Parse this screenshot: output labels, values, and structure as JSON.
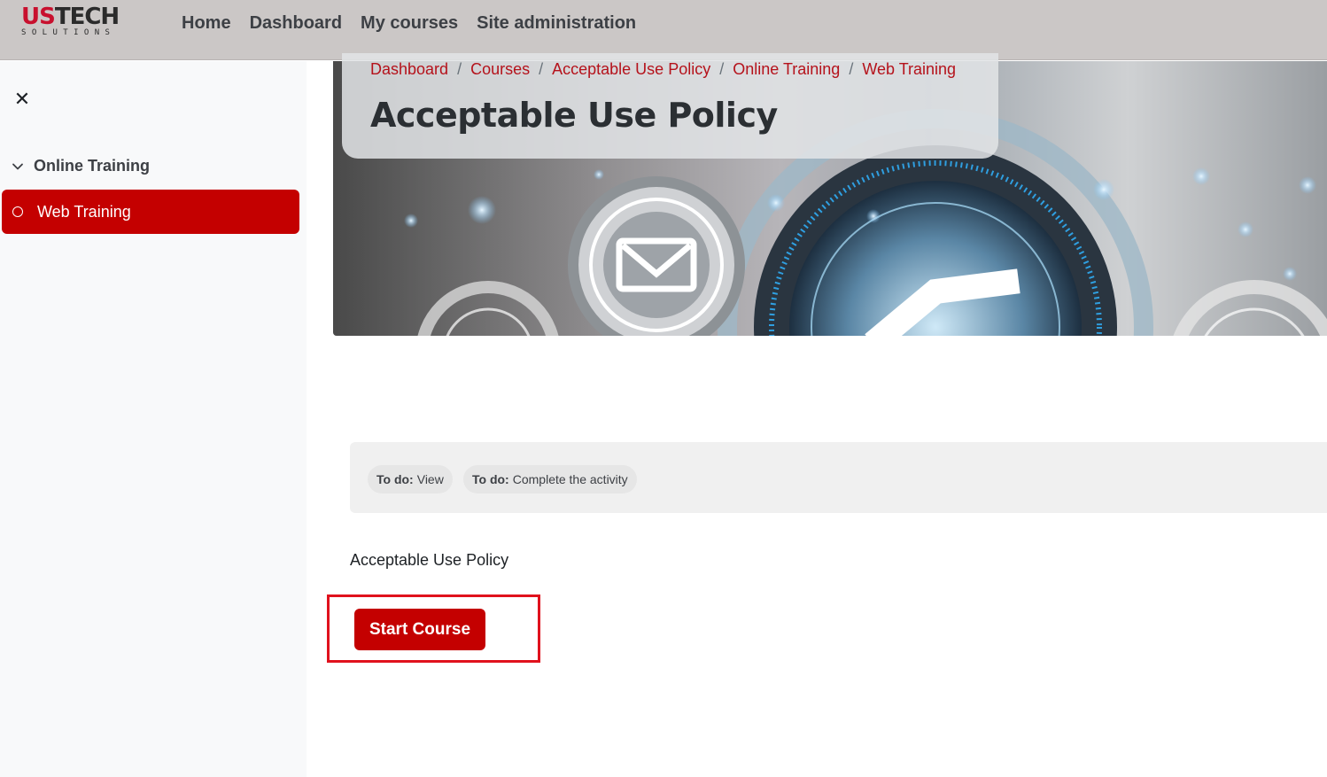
{
  "brand": {
    "logo_us": "US",
    "logo_tech": "TECH",
    "logo_sub": "SOLUTIONS"
  },
  "nav": {
    "items": [
      "Home",
      "Dashboard",
      "My courses",
      "Site administration"
    ]
  },
  "sidebar": {
    "close_glyph": "✕",
    "section_title": "Online Training",
    "items": [
      {
        "label": "Web Training"
      }
    ]
  },
  "breadcrumb": [
    "Dashboard",
    "Courses",
    "Acceptable Use Policy",
    "Online Training",
    "Web Training"
  ],
  "breadcrumb_separator": "/",
  "page": {
    "title": "Acceptable Use Policy",
    "description": "Acceptable Use Policy"
  },
  "activity": {
    "badges": [
      {
        "prefix": "To do:",
        "text": "View"
      },
      {
        "prefix": "To do:",
        "text": "Complete the activity"
      }
    ]
  },
  "actions": {
    "start_label": "Start Course"
  },
  "colors": {
    "accent": "#c40000",
    "link": "#b5121b",
    "highlight": "#e0111d",
    "topbar": "#cbc7c6"
  },
  "icons": {
    "close": "close-icon",
    "chevron": "chevron-down-icon",
    "item": "circle-icon",
    "banner_mail": "envelope-icon",
    "banner_check": "checkmark-icon"
  }
}
